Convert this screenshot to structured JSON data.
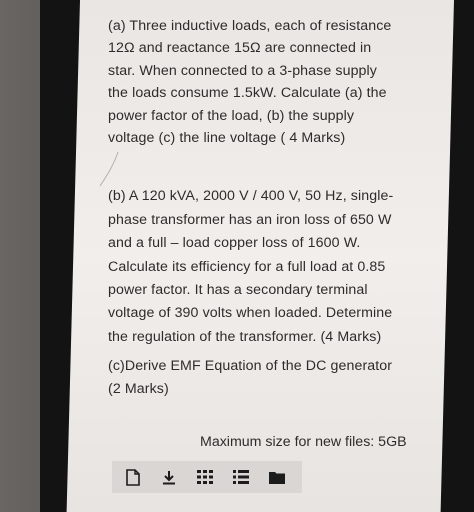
{
  "question_a": {
    "lines": [
      "(a) Three inductive loads, each of resistance",
      "12Ω and reactance 15Ω are connected in",
      "star. When connected to a 3-phase supply",
      "the loads consume 1.5kW. Calculate (a) the",
      "power factor of the load, (b) the supply",
      "voltage (c) the line voltage ( 4 Marks)"
    ]
  },
  "question_b": {
    "lines": [
      "(b) A 120 kVA, 2000 V / 400 V, 50 Hz, single-",
      "phase transformer has an iron loss of 650 W",
      "and a full – load copper loss of 1600 W.",
      "Calculate its efficiency for a full load at 0.85",
      "power factor. It has a secondary terminal",
      "voltage of 390 volts when loaded. Determine",
      "the regulation of the transformer. (4 Marks)"
    ]
  },
  "question_c": {
    "lines": [
      "(c)Derive EMF Equation of the DC generator",
      "(2 Marks)"
    ]
  },
  "footer": {
    "max_size_text": "Maximum size for new files: 5GB"
  },
  "toolbar": {
    "icons": [
      "file-icon",
      "download-icon",
      "grid-icon",
      "list-icon",
      "folder-icon"
    ]
  }
}
